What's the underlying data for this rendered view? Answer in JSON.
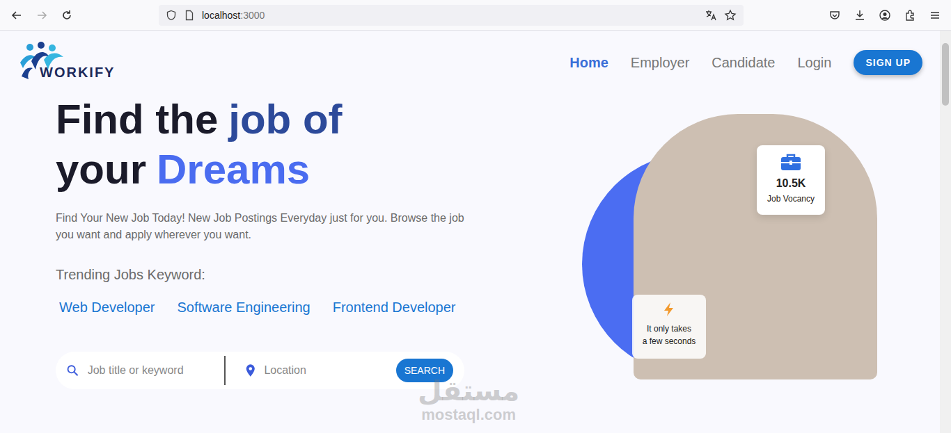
{
  "browser": {
    "url_host": "localhost",
    "url_port": ":3000"
  },
  "logo": {
    "text": "WORKIFY"
  },
  "nav": [
    {
      "label": "Home",
      "selected": true
    },
    {
      "label": "Employer",
      "selected": false
    },
    {
      "label": "Candidate",
      "selected": false
    },
    {
      "label": "Login",
      "selected": false
    }
  ],
  "signup": "SIGN UP",
  "hero": {
    "heading": [
      [
        {
          "text": "Find the",
          "kind": "plain"
        },
        {
          "text": "job of",
          "kind": "navy"
        }
      ],
      [
        {
          "text": "your",
          "kind": "plain"
        },
        {
          "text": "Dreams",
          "kind": "accent"
        }
      ]
    ],
    "description": "Find Your New Job Today! New Job Postings Everyday just for you. Browse the job you want and apply wherever you want.",
    "trending_label": "Trending Jobs Keyword:",
    "keywords": [
      "Web Developer",
      "Software Engineering",
      "Frontend Developer"
    ]
  },
  "search": {
    "keyword_placeholder": "Job title or keyword",
    "location_placeholder": "Location",
    "button": "SEARCH"
  },
  "stats": {
    "value": "10.5K",
    "label": "Job Vocancy"
  },
  "speed": {
    "lines": [
      "It only takes",
      "a few seconds"
    ]
  },
  "watermark": {
    "arabic": "مستقل",
    "latin": "mostaql.com"
  }
}
